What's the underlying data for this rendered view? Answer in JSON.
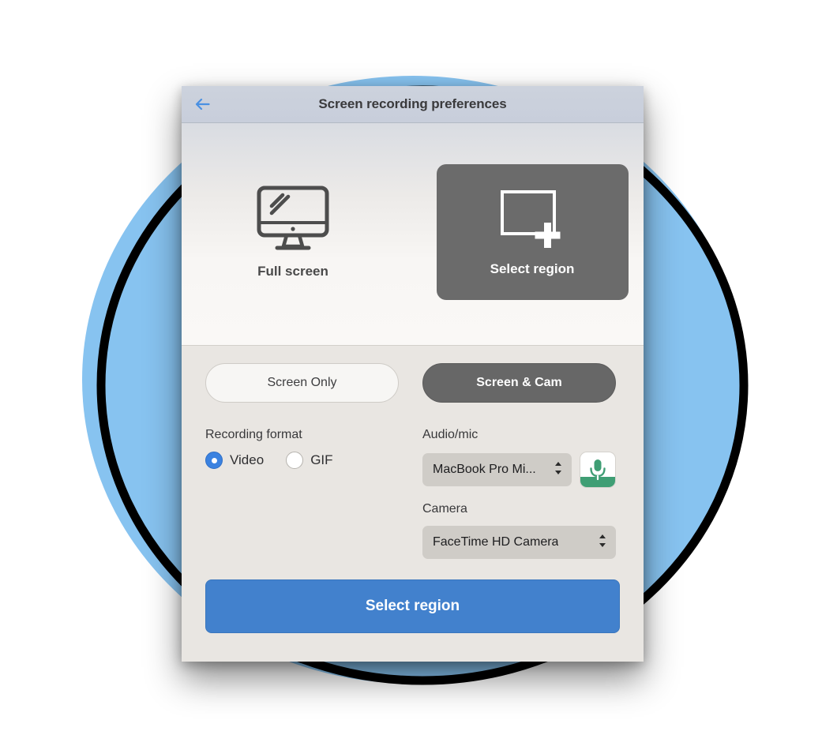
{
  "background": {
    "circle_color": "#87c3f0",
    "sketch_color": "#000000"
  },
  "window": {
    "titlebar": {
      "back_icon": "back-arrow-icon",
      "title": "Screen recording preferences"
    },
    "mode_section": {
      "options": [
        {
          "id": "full-screen",
          "label": "Full screen",
          "icon": "monitor-icon",
          "selected": false
        },
        {
          "id": "select-region",
          "label": "Select region",
          "icon": "region-crosshair-icon",
          "selected": true
        }
      ]
    },
    "settings": {
      "source_toggle": [
        {
          "label": "Screen Only",
          "selected": false
        },
        {
          "label": "Screen & Cam",
          "selected": true
        }
      ],
      "recording_format": {
        "label": "Recording format",
        "options": [
          {
            "label": "Video",
            "selected": true
          },
          {
            "label": "GIF",
            "selected": false
          }
        ]
      },
      "audio": {
        "label": "Audio/mic",
        "value": "MacBook Pro Mi...",
        "mic_icon": "microphone-icon",
        "mic_level_color": "#3f9e74"
      },
      "camera": {
        "label": "Camera",
        "value": "FaceTime HD Camera"
      },
      "primary_action": {
        "label": "Select region",
        "color": "#4281cd"
      }
    }
  }
}
